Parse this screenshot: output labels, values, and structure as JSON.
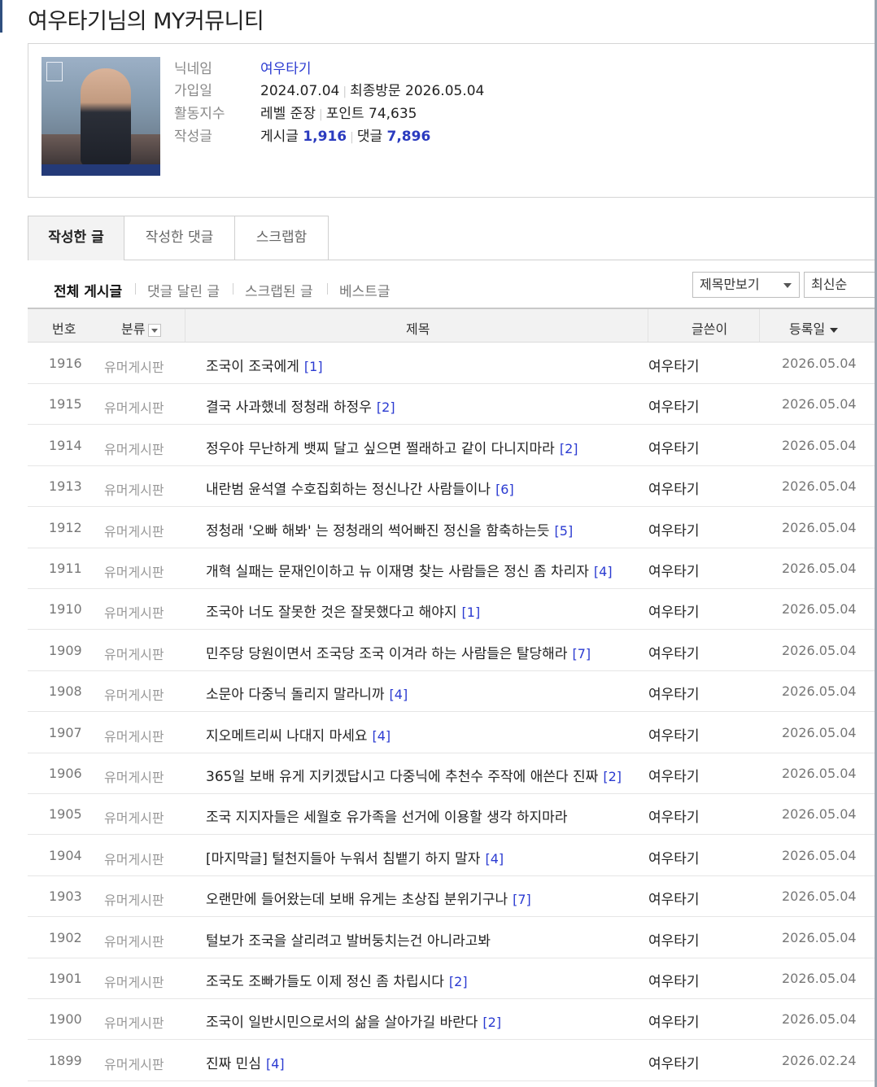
{
  "page": {
    "title": "여우타기님의 MY커뮤니티"
  },
  "profile": {
    "avatar_alt": "profile-photo",
    "labels": {
      "nickname": "닉네임",
      "joined": "가입일",
      "activity": "활동지수",
      "posts": "작성글"
    },
    "nickname": "여우타기",
    "joined_date": "2024.07.04",
    "last_visit_label": "최종방문",
    "last_visit_date": "2026.05.04",
    "level_text": "레벨 준장",
    "points_text": "포인트 74,635",
    "posts_label": "게시글",
    "posts_count": "1,916",
    "comments_label": "댓글",
    "comments_count": "7,896"
  },
  "tabs": [
    {
      "label": "작성한 글",
      "active": true
    },
    {
      "label": "작성한 댓글",
      "active": false
    },
    {
      "label": "스크랩함",
      "active": false
    }
  ],
  "filters": [
    {
      "label": "전체 게시글",
      "active": true
    },
    {
      "label": "댓글 달린 글",
      "active": false
    },
    {
      "label": "스크랩된 글",
      "active": false
    },
    {
      "label": "베스트글",
      "active": false
    }
  ],
  "view_select": {
    "value": "제목만보기"
  },
  "sort_select": {
    "value": "최신순"
  },
  "table": {
    "headers": {
      "num": "번호",
      "category": "분류",
      "title": "제목",
      "author": "글쓴이",
      "date": "등록일"
    },
    "rows": [
      {
        "num": "1916",
        "category": "유머게시판",
        "title": "조국이 조국에게",
        "comments": "[1]",
        "author": "여우타기",
        "date": "2026.05.04"
      },
      {
        "num": "1915",
        "category": "유머게시판",
        "title": "결국 사과했네 정청래 하정우",
        "comments": "[2]",
        "author": "여우타기",
        "date": "2026.05.04"
      },
      {
        "num": "1914",
        "category": "유머게시판",
        "title": "정우야 무난하게 뱃찌 달고 싶으면 쩔래하고 같이 다니지마라",
        "comments": "[2]",
        "author": "여우타기",
        "date": "2026.05.04"
      },
      {
        "num": "1913",
        "category": "유머게시판",
        "title": "내란범 윤석열 수호집회하는 정신나간 사람들이나",
        "comments": "[6]",
        "author": "여우타기",
        "date": "2026.05.04"
      },
      {
        "num": "1912",
        "category": "유머게시판",
        "title": "정청래 '오빠 해봐' 는 정청래의 썩어빠진 정신을 함축하는듯",
        "comments": "[5]",
        "author": "여우타기",
        "date": "2026.05.04"
      },
      {
        "num": "1911",
        "category": "유머게시판",
        "title": "개혁 실패는 문재인이하고 뉴 이재명 찾는 사람들은 정신 좀 차리자",
        "comments": "[4]",
        "author": "여우타기",
        "date": "2026.05.04"
      },
      {
        "num": "1910",
        "category": "유머게시판",
        "title": "조국아 너도 잘못한 것은 잘못했다고 해야지",
        "comments": "[1]",
        "author": "여우타기",
        "date": "2026.05.04"
      },
      {
        "num": "1909",
        "category": "유머게시판",
        "title": "민주당 당원이면서 조국당 조국 이겨라 하는 사람들은 탈당해라",
        "comments": "[7]",
        "author": "여우타기",
        "date": "2026.05.04"
      },
      {
        "num": "1908",
        "category": "유머게시판",
        "title": "소문아 다중닉 돌리지 말라니까",
        "comments": "[4]",
        "author": "여우타기",
        "date": "2026.05.04"
      },
      {
        "num": "1907",
        "category": "유머게시판",
        "title": "지오메트리씨 나대지 마세요",
        "comments": "[4]",
        "author": "여우타기",
        "date": "2026.05.04"
      },
      {
        "num": "1906",
        "category": "유머게시판",
        "title": "365일 보배 유게 지키겠답시고 다중닉에 추천수 주작에 애쓴다 진짜",
        "comments": "[2]",
        "author": "여우타기",
        "date": "2026.05.04"
      },
      {
        "num": "1905",
        "category": "유머게시판",
        "title": "조국 지지자들은 세월호 유가족을 선거에 이용할 생각 하지마라",
        "comments": "",
        "author": "여우타기",
        "date": "2026.05.04"
      },
      {
        "num": "1904",
        "category": "유머게시판",
        "title": "[마지막글] 털천지들아 누워서 침뱉기 하지 말자",
        "comments": "[4]",
        "author": "여우타기",
        "date": "2026.05.04"
      },
      {
        "num": "1903",
        "category": "유머게시판",
        "title": "오랜만에 들어왔는데 보배 유게는 초상집 분위기구나",
        "comments": "[7]",
        "author": "여우타기",
        "date": "2026.05.04"
      },
      {
        "num": "1902",
        "category": "유머게시판",
        "title": "털보가 조국을 살리려고 발버둥치는건 아니라고봐",
        "comments": "",
        "author": "여우타기",
        "date": "2026.05.04"
      },
      {
        "num": "1901",
        "category": "유머게시판",
        "title": "조국도 조빠가들도 이제 정신 좀 차립시다",
        "comments": "[2]",
        "author": "여우타기",
        "date": "2026.05.04"
      },
      {
        "num": "1900",
        "category": "유머게시판",
        "title": "조국이 일반시민으로서의 삶을 살아가길 바란다",
        "comments": "[2]",
        "author": "여우타기",
        "date": "2026.05.04"
      },
      {
        "num": "1899",
        "category": "유머게시판",
        "title": "진짜 민심",
        "comments": "[4]",
        "author": "여우타기",
        "date": "2026.02.24"
      }
    ]
  }
}
